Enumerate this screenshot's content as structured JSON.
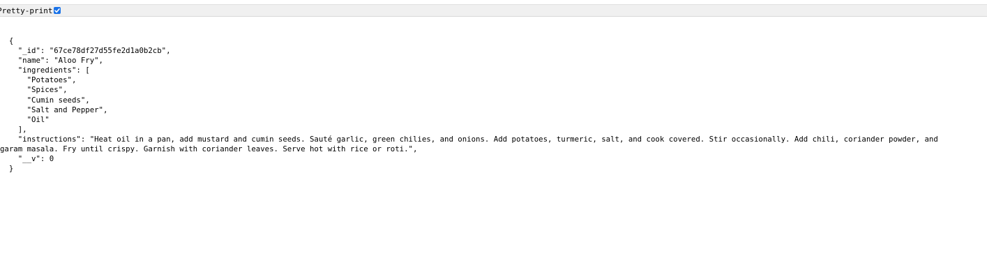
{
  "toolbar": {
    "pretty_print_label": "Pretty-print",
    "pretty_print_checked": true,
    "accent_color": "#1a73e8"
  },
  "json_lines": [
    "  {",
    "    \"_id\": \"67ce78df27d55fe2d1a0b2cb\",",
    "    \"name\": \"Aloo Fry\",",
    "    \"ingredients\": [",
    "      \"Potatoes\",",
    "      \"Spices\",",
    "      \"Cumin seeds\",",
    "      \"Salt and Pepper\",",
    "      \"Oil\"",
    "    ],",
    "    \"instructions\": \"Heat oil in a pan, add mustard and cumin seeds. Sauté garlic, green chilies, and onions. Add potatoes, turmeric, salt, and cook covered. Stir occasionally. Add chili, coriander powder, and",
    "garam masala. Fry until crispy. Garnish with coriander leaves. Serve hot with rice or roti.\",",
    "    \"__v\": 0",
    "  }"
  ]
}
